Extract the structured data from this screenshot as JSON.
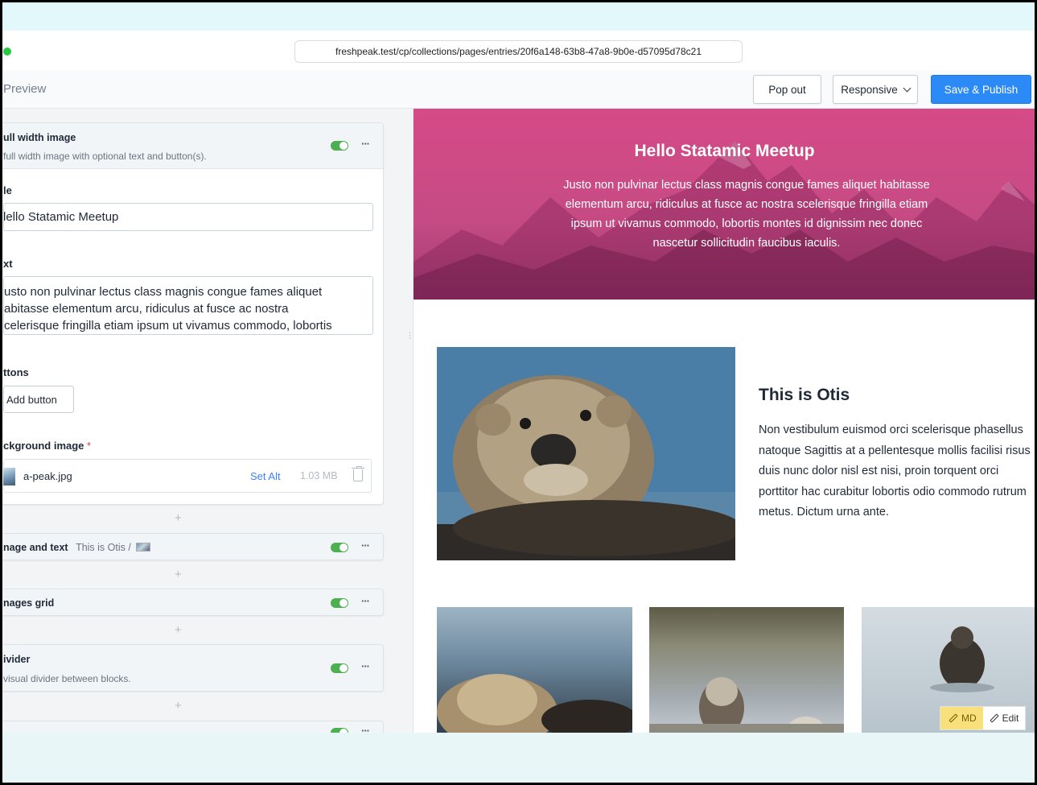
{
  "browser": {
    "url": "freshpeak.test/cp/collections/pages/entries/20f6a148-63b8-47a8-9b0e-d57095d78c21"
  },
  "header": {
    "title": "Preview",
    "pop_out_label": "Pop out",
    "responsive_label": "Responsive",
    "save_label": "Save & Publish"
  },
  "editor": {
    "full_width_set": {
      "name": "ull width image",
      "description": "full width image with optional text and button(s).",
      "title_label": "le",
      "title_value": "lello Statamic Meetup",
      "text_label": "xt",
      "text_lines": [
        "usto non pulvinar lectus class magnis congue fames aliquet",
        "abitasse elementum arcu, ridiculus at fusce ac nostra",
        "celerisque fringilla etiam ipsum ut vivamus commodo, lobortis"
      ],
      "buttons_label": "ttons",
      "add_button_label": "Add button",
      "bg_label": "ckground image",
      "required_mark": "*",
      "asset": {
        "filename": "a-peak.jpg",
        "set_alt": "Set Alt",
        "size": "1.03 MB"
      }
    },
    "sets": [
      {
        "name": "nage and text",
        "preview": "This is Otis /",
        "description": ""
      },
      {
        "name": "nages grid",
        "preview": "",
        "description": ""
      },
      {
        "name": "ivider",
        "preview": "",
        "description": "visual divider between blocks."
      },
      {
        "name": "",
        "preview": "",
        "description": ""
      }
    ],
    "plus_glyph": "+",
    "more_glyph": "···"
  },
  "preview": {
    "hero_title": "Hello Statamic Meetup",
    "hero_lines": [
      "Justo non pulvinar lectus class magnis congue fames aliquet habitasse",
      "elementum arcu, ridiculus at fusce ac nostra scelerisque fringilla etiam",
      "ipsum ut vivamus commodo, lobortis montes id dignissim nec donec",
      "nascetur sollicitudin faucibus iaculis."
    ],
    "otis_title": "This is Otis",
    "otis_lines": [
      "Non vestibulum euismod orci scelerisque phasellus",
      "natoque Sagittis at a pellentesque mollis facilisi risus",
      "duis nunc dolor nisl est nisi, proin torquent orci",
      "porttitor hac curabitur lobortis odio commodo rutrum",
      "metus. Dictum urna ante."
    ],
    "toolbar": {
      "md_label": "MD",
      "edit_label": "Edit"
    }
  },
  "colors": {
    "accent": "#2b8af5",
    "toggle_on": "#4caf50",
    "hero_overlay": "#d63e80"
  }
}
